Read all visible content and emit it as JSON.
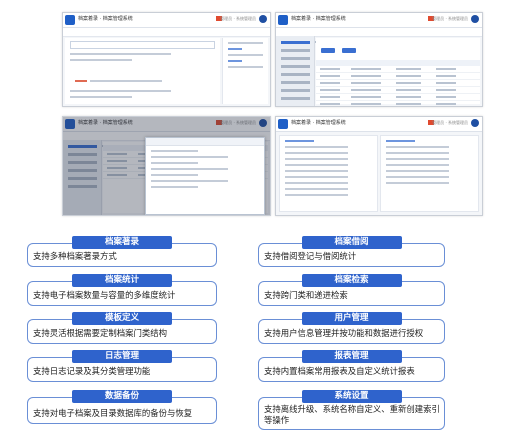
{
  "screens": {
    "topbar_title": "档案着录 · 档案管理系统",
    "user_text": "管理员 · 系统管理员",
    "accent": "#2f63cc",
    "alert_color": "#e04a2f"
  },
  "features_left": [
    {
      "label": "档案著录",
      "desc": "支持多种档案著录方式"
    },
    {
      "label": "档案统计",
      "desc": "支持电子档案数量与容量的多维度统计"
    },
    {
      "label": "模板定义",
      "desc": "支持灵活根据需要定制档案门类结构"
    },
    {
      "label": "日志管理",
      "desc": "支持日志记录及其分类管理功能"
    },
    {
      "label": "数据备份",
      "desc": "支持对电子档案及目录数据库的备份与恢复"
    }
  ],
  "features_right": [
    {
      "label": "档案借阅",
      "desc": "支持借阅登记与借阅统计"
    },
    {
      "label": "档案检索",
      "desc": "支持跨门类和递进检索"
    },
    {
      "label": "用户管理",
      "desc": "支持用户信息管理并按功能和数据进行授权"
    },
    {
      "label": "报表管理",
      "desc": "支持内置档案常用报表及自定义统计报表"
    },
    {
      "label": "系统设置",
      "desc": "支持离线升级、系统名称自定义、重新创建索引等操作"
    }
  ]
}
